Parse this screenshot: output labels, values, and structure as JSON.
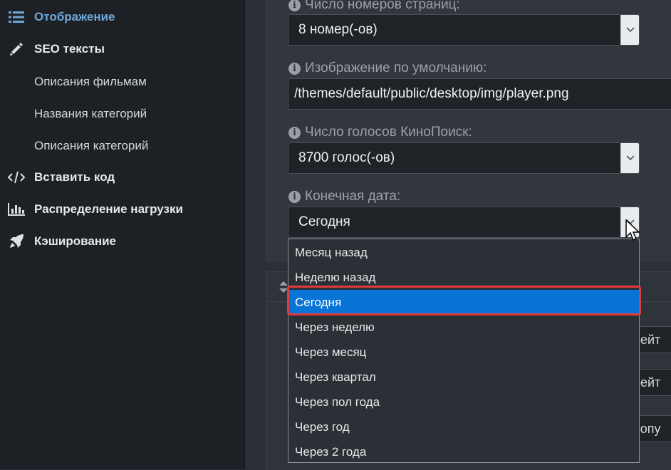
{
  "sidebar": {
    "items": [
      {
        "label": "Отображение",
        "icon": "list-icon",
        "active": true
      },
      {
        "label": "SEO тексты",
        "icon": "pencil-icon"
      },
      {
        "label": "Вставить код",
        "icon": "code-icon"
      },
      {
        "label": "Распределение нагрузки",
        "icon": "bar-chart-icon"
      },
      {
        "label": "Кэширование",
        "icon": "rocket-icon"
      }
    ],
    "seo_subitems": [
      "Описания фильмам",
      "Названия категорий",
      "Описания категорий"
    ]
  },
  "form": {
    "pages_count": {
      "label": "Число номеров страниц:",
      "value": "8 номер(-ов)"
    },
    "default_image": {
      "label": "Изображение по умолчанию:",
      "value": "/themes/default/public/desktop/img/player.png"
    },
    "kinopoisk_votes": {
      "label": "Число голосов КиноПоиск:",
      "value": "8700 голос(-ов)"
    },
    "end_date": {
      "label": "Конечная дата:",
      "value": "Сегодня",
      "options": [
        "Месяц назад",
        "Неделю назад",
        "Сегодня",
        "Через неделю",
        "Через месяц",
        "Через квартал",
        "Через пол года",
        "Через год",
        "Через 2 года"
      ],
      "selected_index": 2
    }
  },
  "background_fields": [
    "рейт",
    "рейт",
    "попу"
  ],
  "colors": {
    "accent": "#6ea6d8",
    "selected": "#0a74d6",
    "highlight": "#e03b3b"
  }
}
